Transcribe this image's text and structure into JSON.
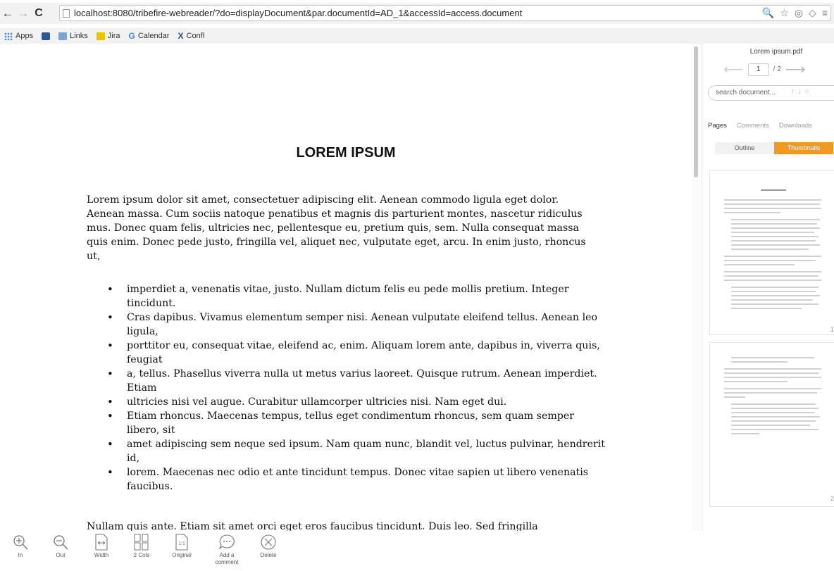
{
  "browser": {
    "url": "localhost:8080/tribefire-webreader/?do=displayDocument&par.documentId=AD_1&accessId=access.document",
    "bookmarks": [
      "Apps",
      "",
      "Links",
      "Jira",
      "Calendar",
      "Confl"
    ],
    "bookmark_icons": [
      "apps-icon",
      "pocket-icon",
      "folder-icon",
      "jira-icon",
      "google-icon",
      "confluence-icon"
    ]
  },
  "document": {
    "title": "LOREM IPSUM",
    "paragraph": "Lorem ipsum dolor sit amet, consectetuer adipiscing elit. Aenean commodo ligula eget dolor. Aenean massa. Cum sociis natoque penatibus et magnis dis parturient montes, nascetur ridiculus mus. Donec quam felis, ultricies nec, pellentesque eu, pretium quis, sem. Nulla consequat massa quis enim. Donec pede justo, fringilla vel, aliquet nec, vulputate eget, arcu. In enim justo, rhoncus ut,",
    "bullets": [
      "imperdiet a, venenatis vitae, justo. Nullam dictum felis eu pede mollis pretium. Integer tincidunt.",
      "Cras dapibus. Vivamus elementum semper nisi. Aenean vulputate eleifend tellus. Aenean leo ligula,",
      "porttitor eu, consequat vitae, eleifend ac, enim. Aliquam lorem ante, dapibus in, viverra quis, feugiat",
      "a, tellus. Phasellus viverra nulla ut metus varius laoreet. Quisque rutrum. Aenean imperdiet. Etiam",
      "ultricies nisi vel augue. Curabitur ullamcorper ultricies nisi. Nam eget dui.",
      "Etiam rhoncus. Maecenas tempus, tellus eget condimentum rhoncus, sem quam semper libero, sit",
      "amet adipiscing sem neque sed ipsum. Nam quam nunc, blandit vel, luctus pulvinar, hendrerit id,",
      "lorem. Maecenas nec odio et ante tincidunt tempus. Donec vitae sapien ut libero venenatis faucibus."
    ],
    "paragraph2": "Nullam quis ante. Etiam sit amet orci eget eros faucibus tincidunt. Duis leo. Sed fringilla"
  },
  "panel": {
    "file_name": "Lorem ipsum.pdf",
    "current_page": "1",
    "page_total": "/ 2",
    "search_placeholder": "search document...",
    "tabs": [
      "Pages",
      "Comments",
      "Downloads"
    ],
    "toggle": [
      "Outline",
      "Thumbnails"
    ],
    "thumb_numbers": [
      "1",
      "2"
    ]
  },
  "toolbar": {
    "tools": [
      {
        "label": "In",
        "icon": "zoom-in-icon"
      },
      {
        "label": "Out",
        "icon": "zoom-out-icon"
      },
      {
        "label": "Width",
        "icon": "fit-width-icon"
      },
      {
        "label": "2 Cols",
        "icon": "two-columns-icon"
      },
      {
        "label": "Original",
        "icon": "original-size-icon"
      },
      {
        "label": "Add a comment",
        "icon": "add-comment-icon"
      },
      {
        "label": "Delete",
        "icon": "delete-icon"
      }
    ]
  },
  "colors": {
    "accent": "#f29624"
  }
}
